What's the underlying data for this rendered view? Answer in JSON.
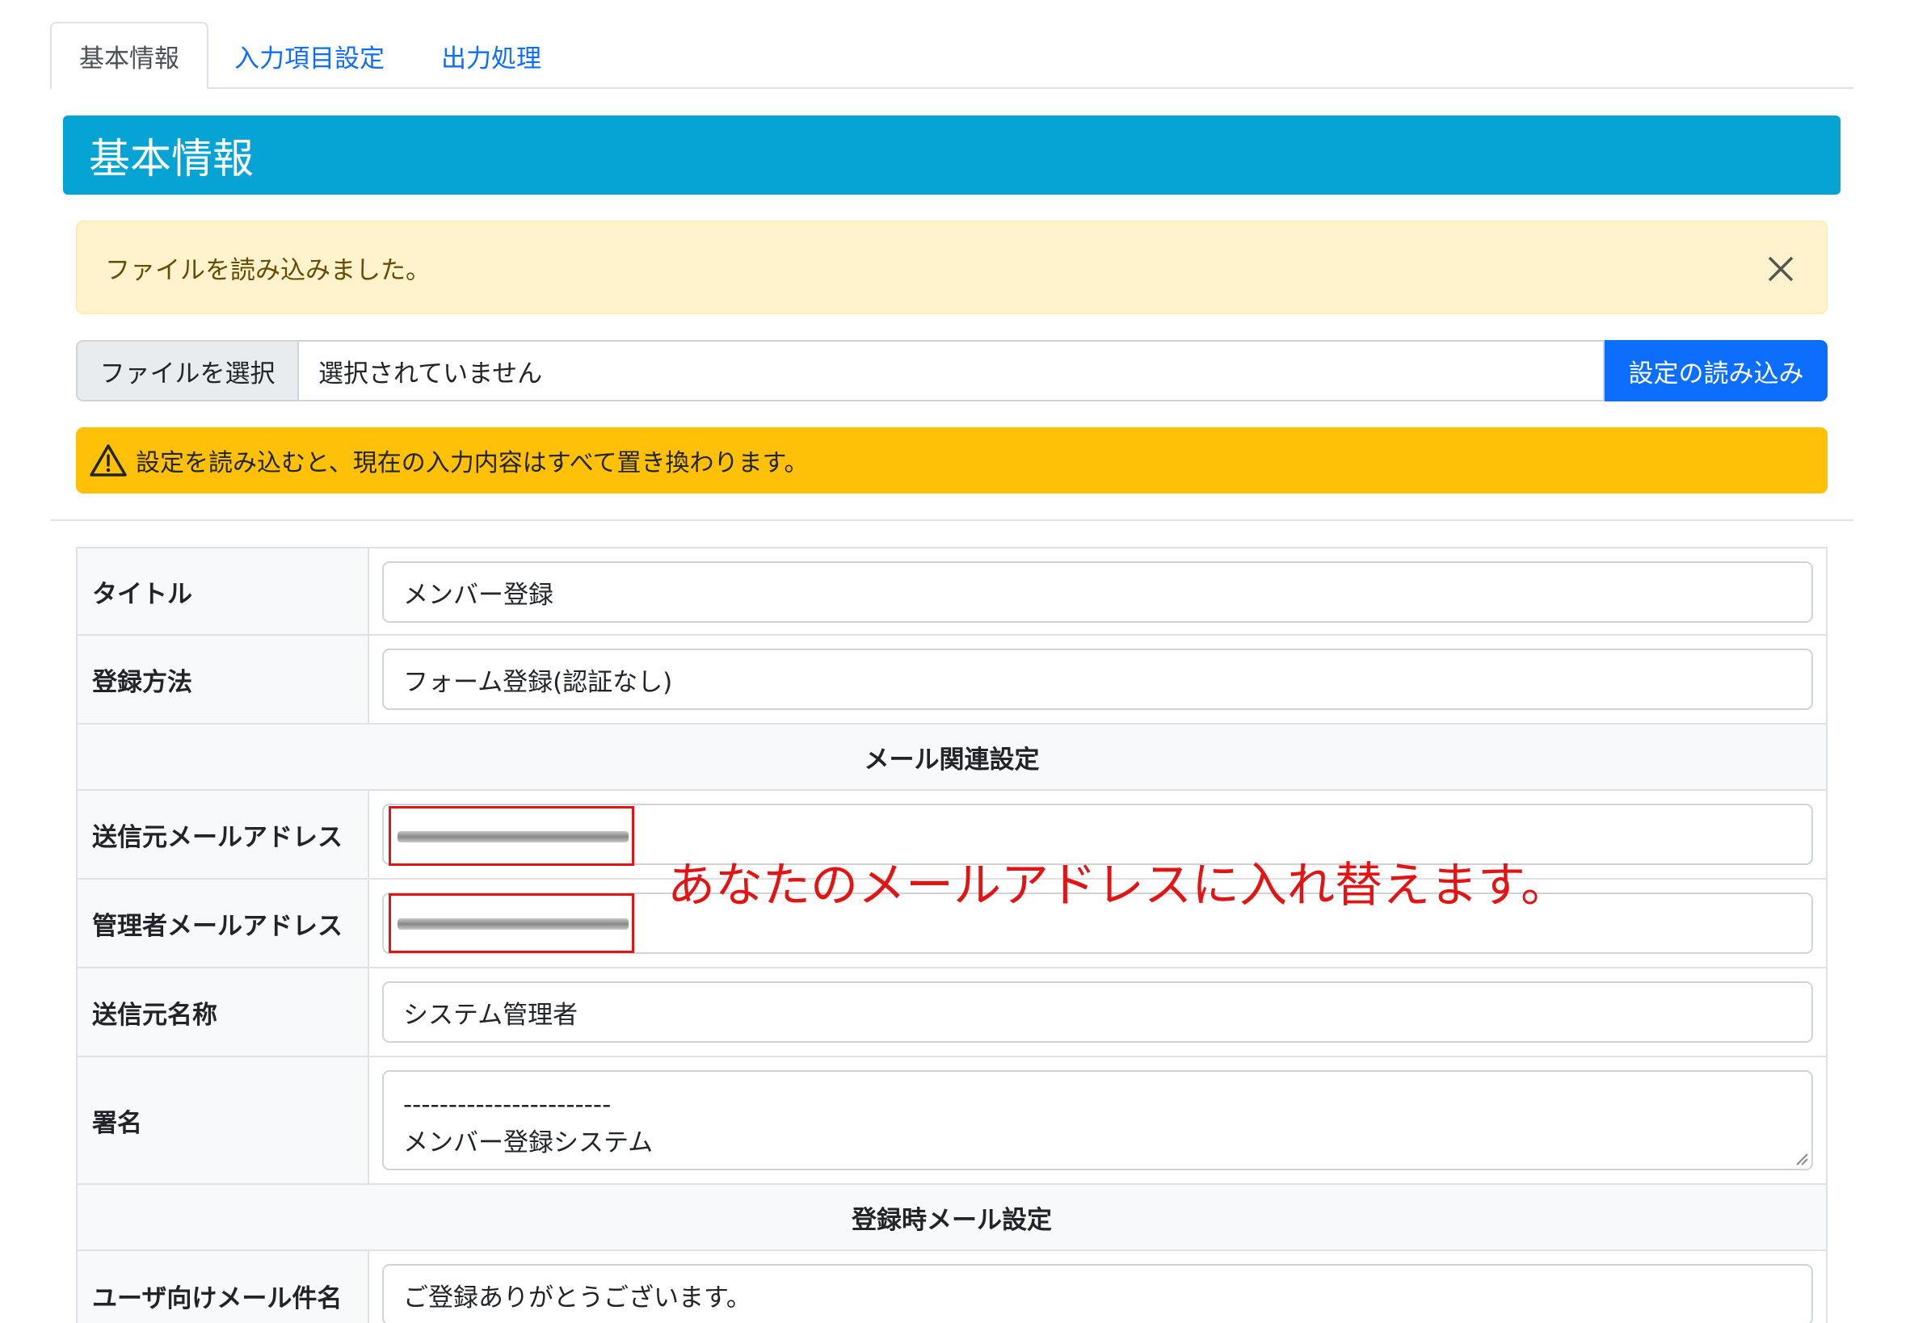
{
  "tabs": [
    {
      "label": "基本情報",
      "active": true
    },
    {
      "label": "入力項目設定",
      "active": false
    },
    {
      "label": "出力処理",
      "active": false
    }
  ],
  "section": {
    "title": "基本情報"
  },
  "alert": {
    "message": "ファイルを読み込みました。"
  },
  "file": {
    "choose_label": "ファイルを選択",
    "no_file": "選択されていません",
    "load_label": "設定の読み込み"
  },
  "warning": {
    "message": "設定を読み込むと、現在の入力内容はすべて置き換わります。"
  },
  "form": {
    "title_label": "タイトル",
    "title_value": "メンバー登録",
    "method_label": "登録方法",
    "method_value": "フォーム登録(認証なし)",
    "mail_section": "メール関連設定",
    "from_label": "送信元メールアドレス",
    "admin_label": "管理者メールアドレス",
    "from_name_label": "送信元名称",
    "from_name_value": "システム管理者",
    "signature_label": "署名",
    "signature_lines": [
      "-----------------------",
      "メンバー登録システム"
    ],
    "register_section": "登録時メール設定",
    "user_subject_label": "ユーザ向けメール件名",
    "user_subject_value": "ご登録ありがとうございます。"
  },
  "annotation": {
    "text": "あなたのメールアドレスに入れ替えます。"
  },
  "colors": {
    "header_bg": "#05a4d5",
    "alert_bg": "#fff3cd",
    "warning_bg": "#ffc107",
    "primary": "#0d6efd",
    "annotation": "#e31414"
  }
}
